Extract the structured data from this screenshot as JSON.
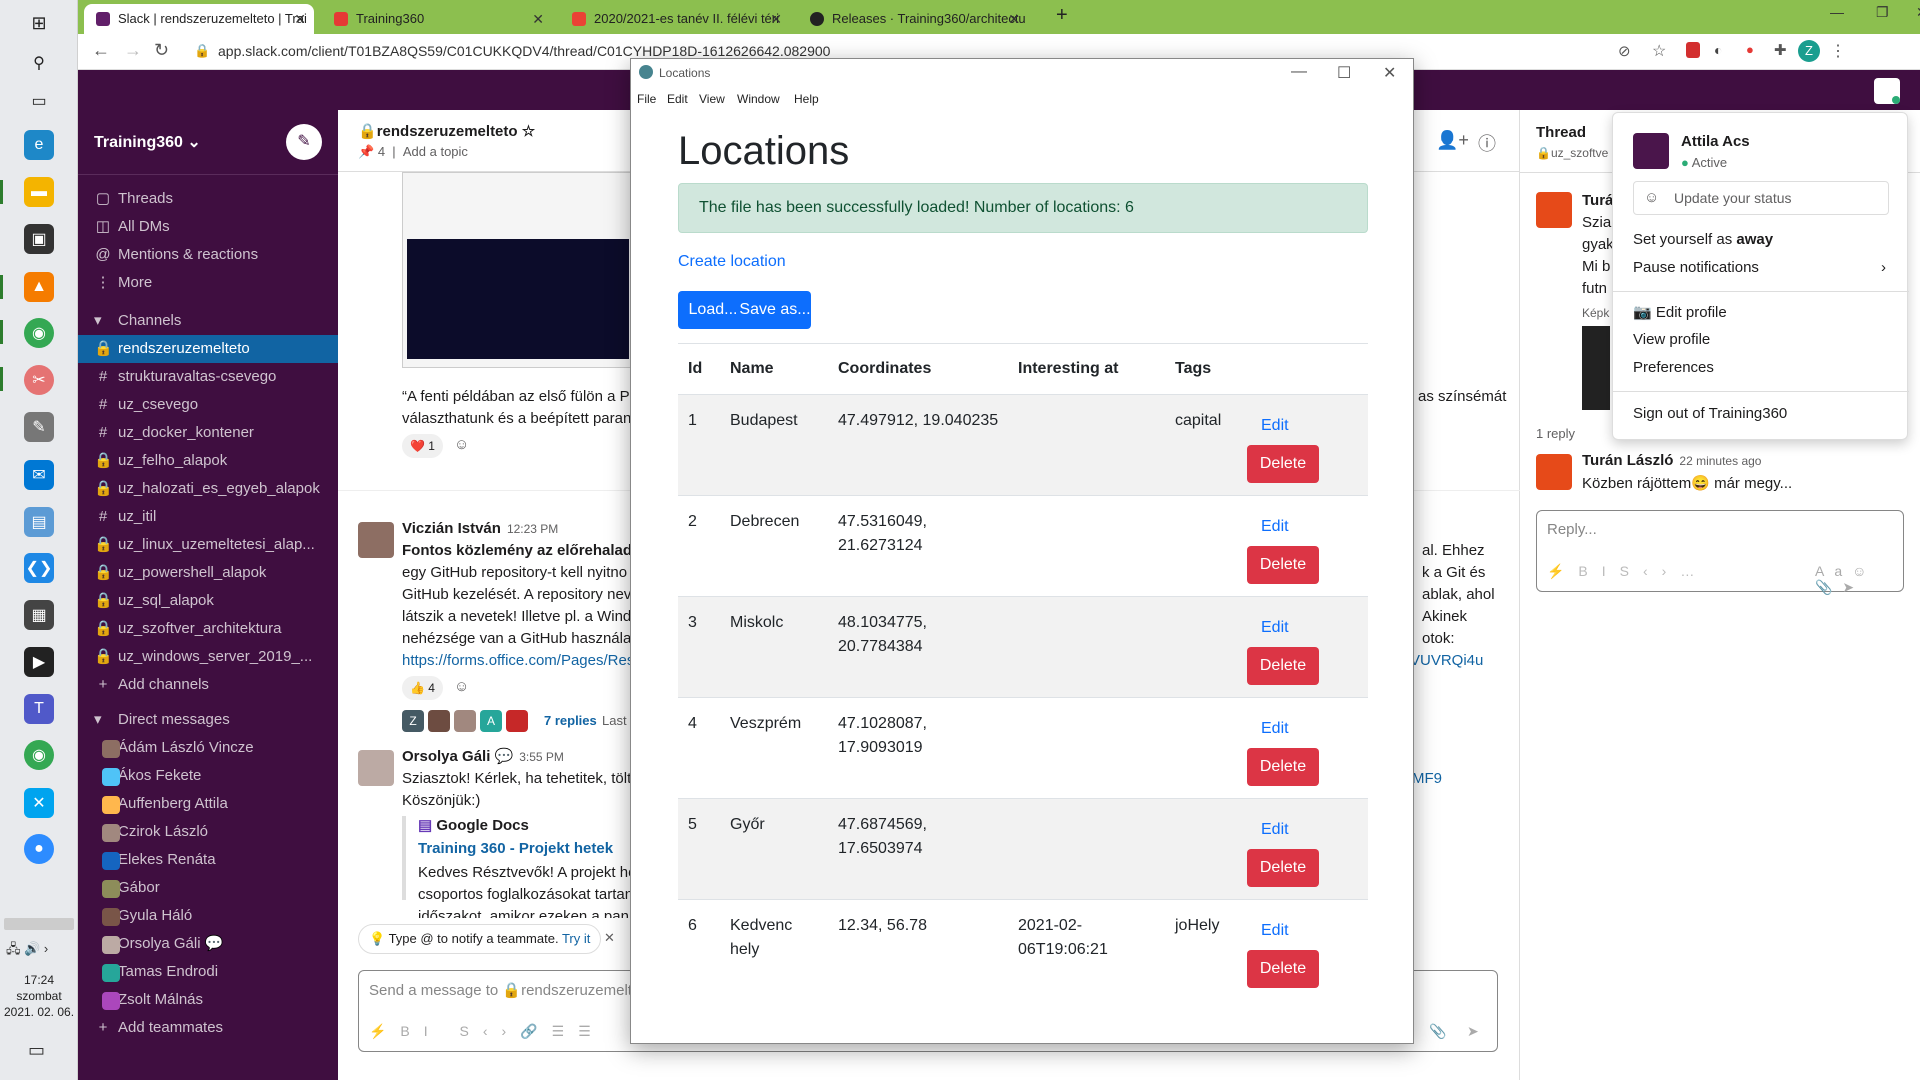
{
  "taskbar": {
    "clock_time": "17:24",
    "clock_day": "szombat",
    "clock_date": "2021. 02. 06."
  },
  "browser": {
    "tabs": [
      {
        "label": "Slack | rendszeruzemelteto | Trai",
        "active": true
      },
      {
        "label": "Training360",
        "active": false
      },
      {
        "label": "2020/2021-es tanév II. félévi téri",
        "active": false
      },
      {
        "label": "Releases · Training360/architectu",
        "active": false
      }
    ],
    "url": "app.slack.com/client/T01BZA8QS59/C01CUKKQDV4/thread/C01CYHDP18D-1612626642.082900"
  },
  "slack": {
    "workspace": "Training360",
    "nav": [
      {
        "icon": "threads-icon",
        "label": "Threads"
      },
      {
        "icon": "all-dms-icon",
        "label": "All DMs"
      },
      {
        "icon": "mentions-icon",
        "label": "Mentions & reactions"
      },
      {
        "icon": "more-icon",
        "label": "More"
      }
    ],
    "channels_header": "Channels",
    "channels": [
      "rendszeruzemelteto",
      "strukturavaltas-csevego",
      "uz_csevego",
      "uz_docker_kontener",
      "uz_felho_alapok",
      "uz_halozati_es_egyeb_alapok",
      "uz_itil",
      "uz_linux_uzemeltetesi_alap...",
      "uz_powershell_alapok",
      "uz_sql_alapok",
      "uz_szoftver_architektura",
      "uz_windows_server_2019_..."
    ],
    "add_channels": "Add channels",
    "dm_header": "Direct messages",
    "dms": [
      "Ádám László Vincze",
      "Ákos Fekete",
      "Auffenberg Attila",
      "Czirok László",
      "Elekes Renáta",
      "Gábor",
      "Gyula Háló",
      "Orsolya Gáli",
      "Tamas Endrodi",
      "Zsolt Málnás"
    ],
    "add_teammates": "Add teammates",
    "channel_name": "rendszeruzemelteto",
    "pin_count": "4",
    "add_topic": "Add a topic",
    "messages": {
      "m1_text": "“A fenti példában az első fülön a Po",
      "m1_text2": "választhatunk és a beépített paranc",
      "m1_text_right": "as színsémát",
      "m1_reaction": "1",
      "m2_name": "Viczián István",
      "m2_time": "12:23 PM",
      "m2_l1": "Fontos közlemény az előrehaladás",
      "m2_l2": "egy GitHub repository-t kell nyitno",
      "m2_l3": "GitHub kezelését. A repository nev",
      "m2_l4": "látszik a nevetek! Illetve pl. a Wind",
      "m2_l5": "nehézsége van a GitHub használata",
      "m2_link": "https://forms.office.com/Pages/Res",
      "m2_r1": "al. Ehhez",
      "m2_r2": "k a Git és",
      "m2_r3": "ablak, ahol",
      "m2_r4": "Akinek",
      "m2_r5": "otok:",
      "m2_r_link": "VUVRQi4u",
      "m2_reaction": "4",
      "m2_replies": "7 replies",
      "m2_last": "Last",
      "m3_name": "Orsolya Gáli",
      "m3_time": "3:55 PM",
      "m3_l1": "Sziasztok! Kérlek, ha tehetitek, tölt",
      "m3_l2": "Köszönjük:)",
      "m3_r_link": "MF9",
      "gdocs_title": "Google Docs",
      "gdocs_link": "Training 360 - Projekt hetek",
      "gdocs_l1": "Kedves Résztvevők! A projekt he",
      "gdocs_l2": "csoportos foglalkozásokat tartan",
      "gdocs_l3": "időszakot, amikor ezeken a pan"
    },
    "hint": "Type @ to notify a teammate.",
    "hint_link": "Try it",
    "input_placeholder": "Send a message to 🔒rendszeruzemeltet",
    "thread": {
      "title": "Thread",
      "channel": "uz_szoftve",
      "snippet_name": "Turá",
      "snippet_1": "Szia",
      "snippet_2": "gyak",
      "snippet_3": "Mi b",
      "snippet_4": "futn",
      "snippet_5": "Képk",
      "reply_count": "1 reply",
      "reply_name": "Turán László",
      "reply_time": "22 minutes ago",
      "reply_text_a": "Közben rájöttem",
      "reply_text_b": " már megy...",
      "reply_placeholder": "Reply..."
    },
    "profile_menu": {
      "name": "Attila Acs",
      "status": "Active",
      "status_placeholder": "Update your status",
      "set_away_prefix": "Set yourself as ",
      "set_away_bold": "away",
      "pause": "Pause notifications",
      "edit_profile": "Edit profile",
      "view_profile": "View profile",
      "preferences": "Preferences",
      "sign_out": "Sign out of Training360"
    }
  },
  "locations_app": {
    "window_title": "Locations",
    "menu": [
      "File",
      "Edit",
      "View",
      "Window",
      "Help"
    ],
    "heading": "Locations",
    "alert": "The file has been successfully loaded! Number of locations: 6",
    "create_link": "Create location",
    "load_button": "Load...",
    "save_button": "Save as...",
    "columns": [
      "Id",
      "Name",
      "Coordinates",
      "Interesting at",
      "Tags"
    ],
    "rows": [
      {
        "id": "1",
        "name": "Budapest",
        "coords": "47.497912, 19.040235",
        "interesting": "",
        "tags": "capital"
      },
      {
        "id": "2",
        "name": "Debrecen",
        "coords": "47.5316049, 21.6273124",
        "interesting": "",
        "tags": ""
      },
      {
        "id": "3",
        "name": "Miskolc",
        "coords": "48.1034775, 20.7784384",
        "interesting": "",
        "tags": ""
      },
      {
        "id": "4",
        "name": "Veszprém",
        "coords": "47.1028087, 17.9093019",
        "interesting": "",
        "tags": ""
      },
      {
        "id": "5",
        "name": "Győr",
        "coords": "47.6874569, 17.6503974",
        "interesting": "",
        "tags": ""
      },
      {
        "id": "6",
        "name": "Kedvenc hely",
        "coords": "12.34, 56.78",
        "interesting": "2021-02-06T19:06:21",
        "tags": "joHely"
      }
    ],
    "edit_label": "Edit",
    "delete_label": "Delete"
  }
}
